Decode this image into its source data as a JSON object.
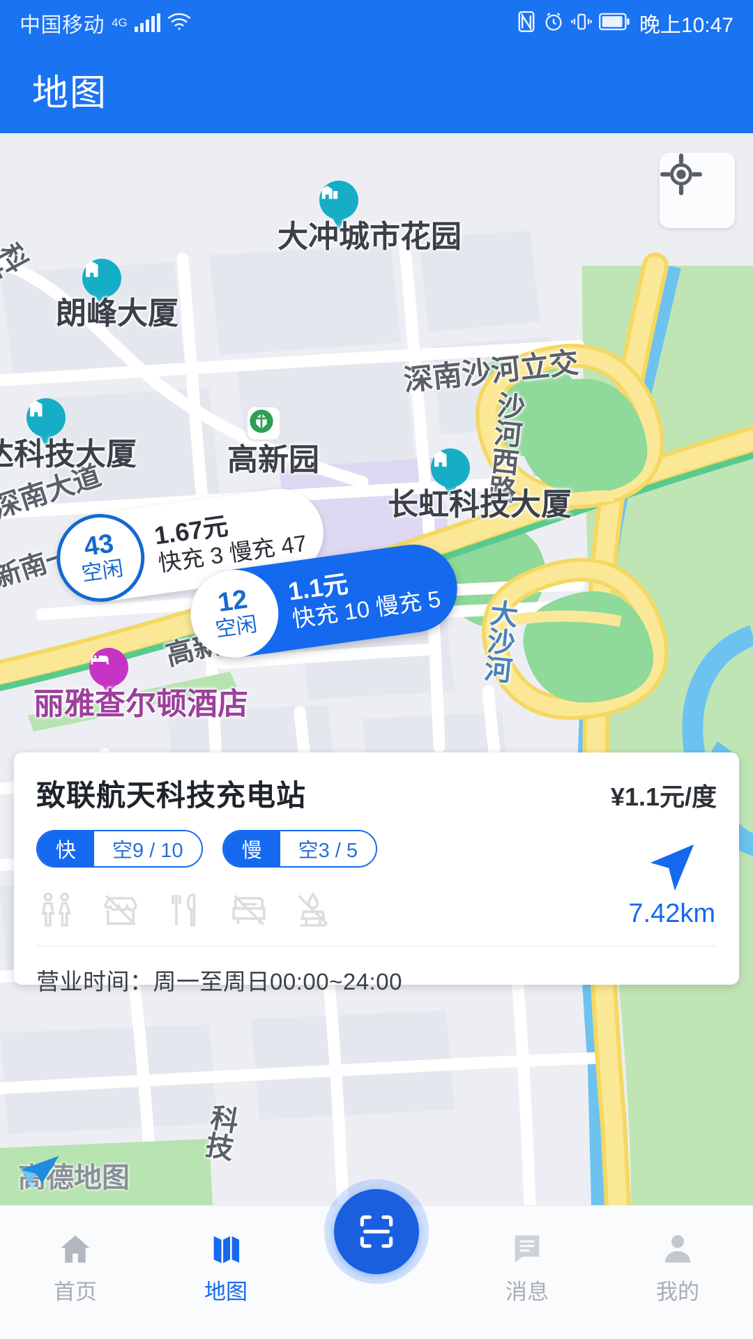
{
  "status_bar": {
    "carrier": "中国移动",
    "network_type": "4G",
    "time": "晚上10:47",
    "icons": [
      "nfc-icon",
      "alarm-icon",
      "vibrate-icon",
      "battery-icon"
    ]
  },
  "header": {
    "title": "地图"
  },
  "map": {
    "provider_watermark": "高德地图",
    "locate_button": "locate-icon",
    "road_labels": [
      {
        "text": "科技路"
      },
      {
        "text": "深南大道"
      },
      {
        "text": "新南一"
      },
      {
        "text": "高新南"
      },
      {
        "text": "沙河西路"
      },
      {
        "text": "大沙河"
      },
      {
        "text": "深南沙河立交"
      },
      {
        "text": "科技"
      }
    ],
    "poi_labels": [
      {
        "text": "大冲城市花园",
        "icon": "building-pin-icon"
      },
      {
        "text": "朗峰大厦",
        "icon": "building-pin-icon"
      },
      {
        "text": "达科技大厦",
        "icon": "building-pin-icon"
      },
      {
        "text": "长虹科技大厦",
        "icon": "building-pin-icon"
      },
      {
        "text": "丽雅查尔顿酒店",
        "icon": "hotel-pin-icon"
      },
      {
        "text": "高新园",
        "icon": "metro-station-icon"
      }
    ],
    "station_markers": [
      {
        "count": "43",
        "status": "空闲",
        "price": "1.67元",
        "connectors": "快充 3 慢充 47",
        "selected": false
      },
      {
        "count": "12",
        "status": "空闲",
        "price": "1.1元",
        "connectors": "快充 10 慢充 5",
        "selected": true
      }
    ]
  },
  "info_card": {
    "station_name": "致联航天科技充电站",
    "price": "¥1.1元/度",
    "badges": [
      {
        "type": "快",
        "count": "空9 / 10"
      },
      {
        "type": "慢",
        "count": "空3 / 5"
      }
    ],
    "amenities": [
      "restroom-icon",
      "convenience-store-icon",
      "restaurant-icon",
      "lounge-icon",
      "car-wash-icon"
    ],
    "distance": "7.42km",
    "navigate_icon": "navigation-arrow-icon",
    "business_hours": "营业时间：周一至周日00:00~24:00"
  },
  "bottom_nav": {
    "items": [
      {
        "label": "首页",
        "icon": "home-icon",
        "active": false
      },
      {
        "label": "地图",
        "icon": "map-icon",
        "active": true
      },
      {
        "label": "消息",
        "icon": "message-icon",
        "active": false
      },
      {
        "label": "我的",
        "icon": "person-icon",
        "active": false
      }
    ],
    "fab": {
      "icon": "scan-icon"
    }
  },
  "colors": {
    "brand_blue": "#1a73f0",
    "accent_blue": "#1469ee",
    "map_bg": "#eceef4",
    "highway_yellow": "#fbe07a",
    "water_blue": "#6cc3f0",
    "park_green": "#b7e3b0",
    "teal_pin": "#16aec7",
    "magenta_pin": "#c534c5"
  }
}
